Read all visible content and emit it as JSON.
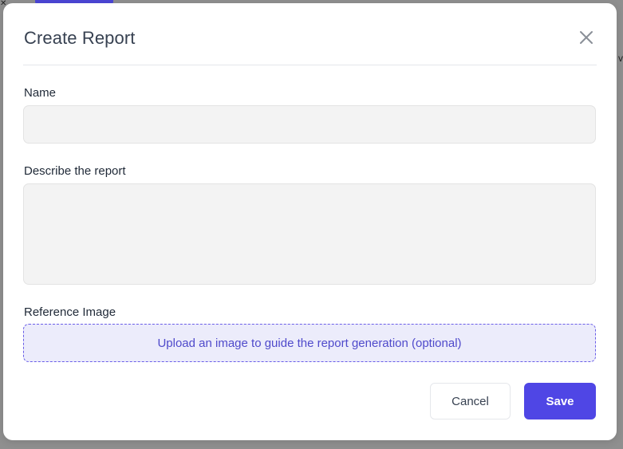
{
  "dialog": {
    "title": "Create Report",
    "close_label": "Close"
  },
  "form": {
    "name": {
      "label": "Name",
      "value": "",
      "placeholder": ""
    },
    "description": {
      "label": "Describe the report",
      "value": "",
      "placeholder": ""
    },
    "reference_image": {
      "label": "Reference Image",
      "upload_text": "Upload an image to guide the report generation (optional)"
    }
  },
  "actions": {
    "cancel_label": "Cancel",
    "save_label": "Save"
  },
  "colors": {
    "accent": "#4f46e5",
    "upload_border": "#6a5ee8",
    "upload_bg": "#ececfb",
    "input_bg": "#f3f3f3"
  },
  "icons": {
    "close": "close-icon"
  }
}
